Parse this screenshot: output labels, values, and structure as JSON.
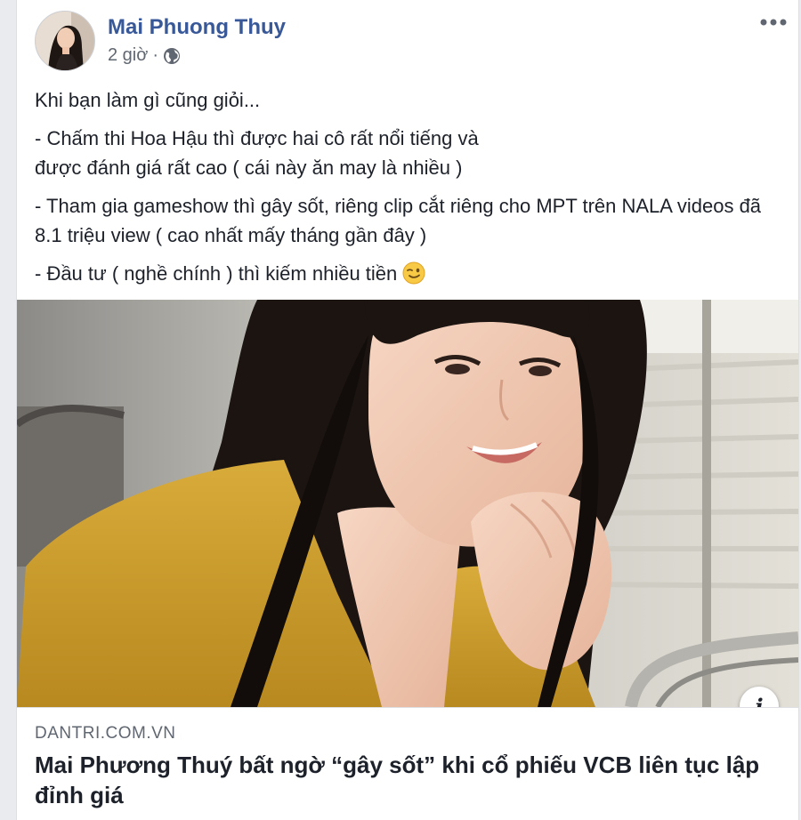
{
  "post": {
    "author": "Mai Phuong Thuy",
    "time": "2 giờ",
    "separator": "·",
    "privacy_icon": "globe-icon",
    "more_icon": "more-options-icon",
    "paragraphs": [
      "Khi bạn làm gì cũng giỏi...",
      "- Chấm thi Hoa Hậu thì được hai cô rất nổi tiếng và\nđược đánh giá rất cao ( cái này ăn may là nhiều )",
      "- Tham gia gameshow thì gây sốt, riêng clip cắt riêng cho MPT trên NALA videos đã 8.1 triệu view ( cao nhất mấy tháng gần đây )",
      "- Đầu tư ( nghề chính ) thì kiếm nhiều tiền"
    ],
    "emoji": "wink-emoji"
  },
  "link": {
    "domain": "DANTRI.COM.VN",
    "title": "Mai Phương Thuý bất ngờ “gây sốt” khi cổ phiếu VCB liên tục lập đỉnh giá",
    "info_label": "i"
  },
  "colors": {
    "author": "#385898",
    "jacket": "#c99a2c",
    "hair": "#1b1411"
  }
}
